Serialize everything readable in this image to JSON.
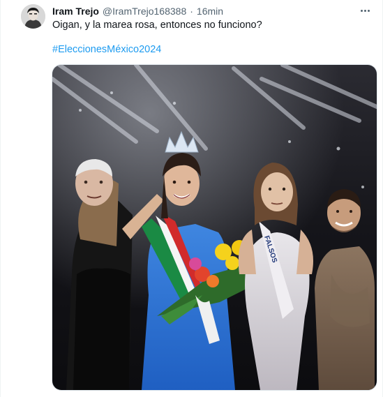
{
  "tweet": {
    "author_name": "Iram Trejo",
    "author_handle": "@IramTrejo168388",
    "separator": "·",
    "time": "16min",
    "text": "Oigan, y la marea rosa, entonces no funciono?",
    "hashtag": "#EleccionesMéxico2024"
  },
  "media": {
    "sash_text": "FALSOS"
  },
  "icons": {
    "more": "more-dots-icon",
    "avatar": "avatar-portrait"
  },
  "colors": {
    "name": "#0f1419",
    "secondary": "#536471",
    "link": "#1d9bf0",
    "border": "#eff3f4"
  }
}
